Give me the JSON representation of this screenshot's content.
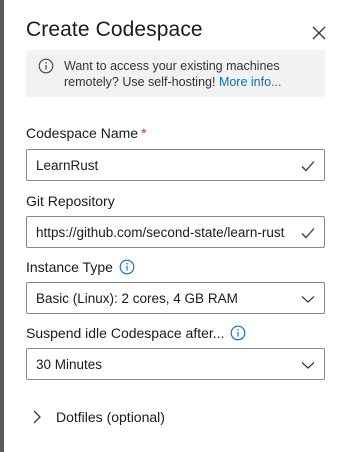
{
  "panel": {
    "title": "Create Codespace",
    "close_icon": "close-icon"
  },
  "info": {
    "icon": "info-icon",
    "text": "Want to access your existing machines remotely? Use self-hosting!",
    "link": "More info..."
  },
  "form": {
    "name": {
      "label": "Codespace Name",
      "required_marker": "*",
      "value": "LearnRust",
      "status_icon": "checkmark-icon"
    },
    "repo": {
      "label": "Git Repository",
      "value": "https://github.com/second-state/learn-rust",
      "status_icon": "checkmark-icon"
    },
    "instance": {
      "label": "Instance Type",
      "info_icon": "info-icon",
      "value": "Basic (Linux): 2 cores, 4 GB RAM",
      "dropdown_icon": "chevron-down-icon"
    },
    "suspend": {
      "label": "Suspend idle Codespace after...",
      "info_icon": "info-icon",
      "value": "30 Minutes",
      "dropdown_icon": "chevron-down-icon"
    },
    "dotfiles": {
      "label": "Dotfiles (optional)",
      "expand_icon": "chevron-right-icon"
    }
  },
  "colors": {
    "link": "#0f6cbd",
    "info_bg": "#f2f2f2",
    "required": "#c4314b",
    "border": "#8a8a8a"
  }
}
